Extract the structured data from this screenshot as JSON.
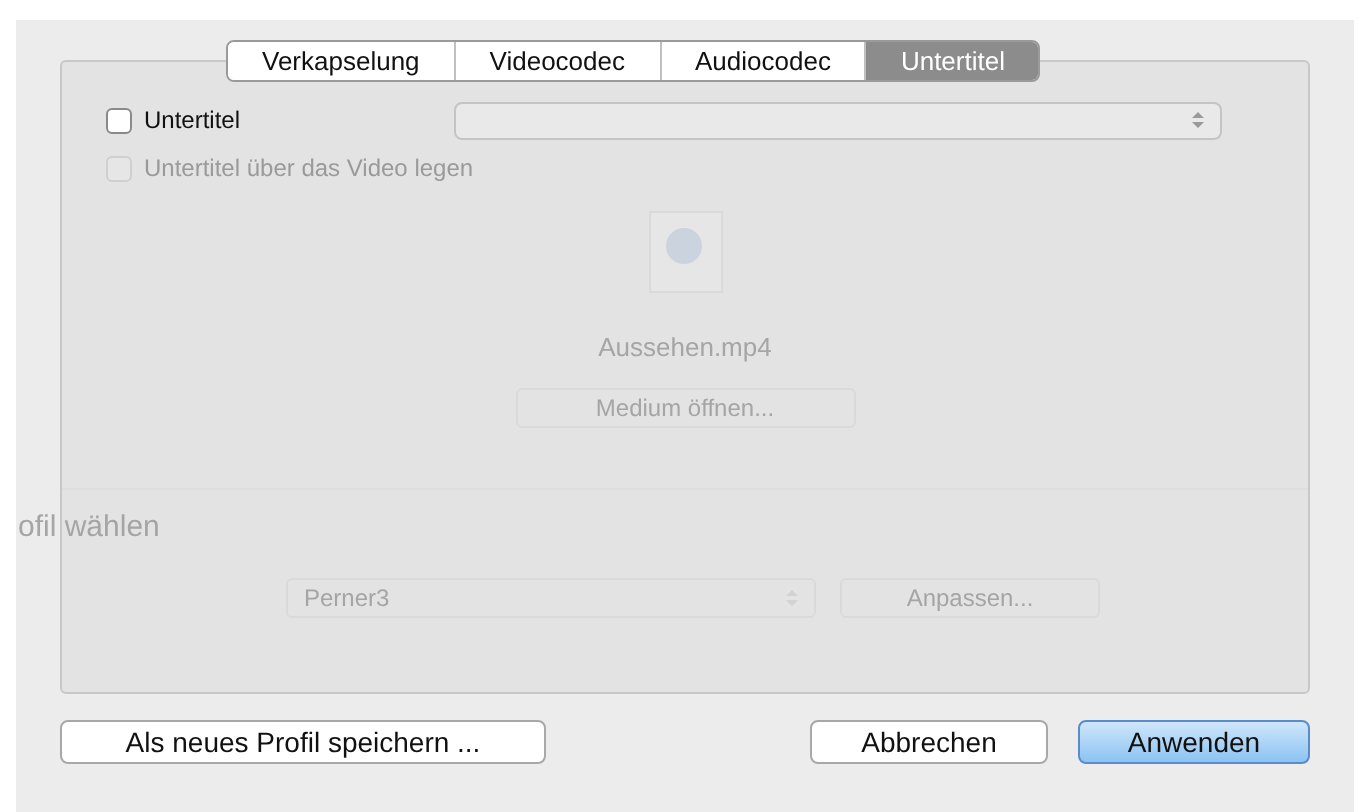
{
  "tabs": [
    {
      "label": "Verkapselung",
      "selected": false
    },
    {
      "label": "Videocodec",
      "selected": false
    },
    {
      "label": "Audiocodec",
      "selected": false
    },
    {
      "label": "Untertitel",
      "selected": true
    }
  ],
  "options": [
    {
      "label": "Untertitel",
      "checked": false,
      "disabled": false
    },
    {
      "label": "Untertitel über das Video legen",
      "checked": false,
      "disabled": true
    }
  ],
  "background": {
    "file_name": "Aussehen.mp4",
    "open_button": "Medium öffnen...",
    "section_title": "ofil wählen",
    "profile": "Perner3",
    "customize_button": "Anpassen..."
  },
  "buttons": [
    {
      "label": "Als neues Profil speichern ...",
      "default": false
    },
    {
      "label": "Abbrechen",
      "default": false
    },
    {
      "label": "Anwenden",
      "default": true
    }
  ]
}
